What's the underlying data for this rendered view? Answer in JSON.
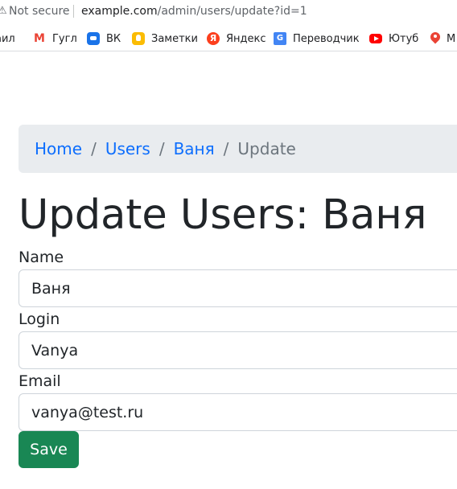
{
  "browser": {
    "security_label": "Not secure",
    "url_host": "example.com",
    "url_path": "/admin/users/update?id=1",
    "bookmarks": [
      {
        "label": "аил",
        "icon": "mail-icon"
      },
      {
        "label": "Гугл",
        "icon": "gmail-icon"
      },
      {
        "label": "ВК",
        "icon": "vk-icon"
      },
      {
        "label": "Заметки",
        "icon": "notes-icon"
      },
      {
        "label": "Яндекс",
        "icon": "yandex-icon"
      },
      {
        "label": "Переводчик",
        "icon": "translate-icon"
      },
      {
        "label": "Ютуб",
        "icon": "youtube-icon"
      },
      {
        "label": "М",
        "icon": "maps-icon"
      }
    ]
  },
  "breadcrumb": {
    "items": [
      "Home",
      "Users",
      "Ваня"
    ],
    "active": "Update",
    "separator": "/"
  },
  "page": {
    "title": "Update Users: Ваня"
  },
  "form": {
    "name_label": "Name",
    "name_value": "Ваня",
    "login_label": "Login",
    "login_value": "Vanya",
    "email_label": "Email",
    "email_value": "vanya@test.ru",
    "save_label": "Save"
  },
  "colors": {
    "link": "#0d6efd",
    "save_button": "#198754",
    "breadcrumb_bg": "#e9ecef"
  }
}
